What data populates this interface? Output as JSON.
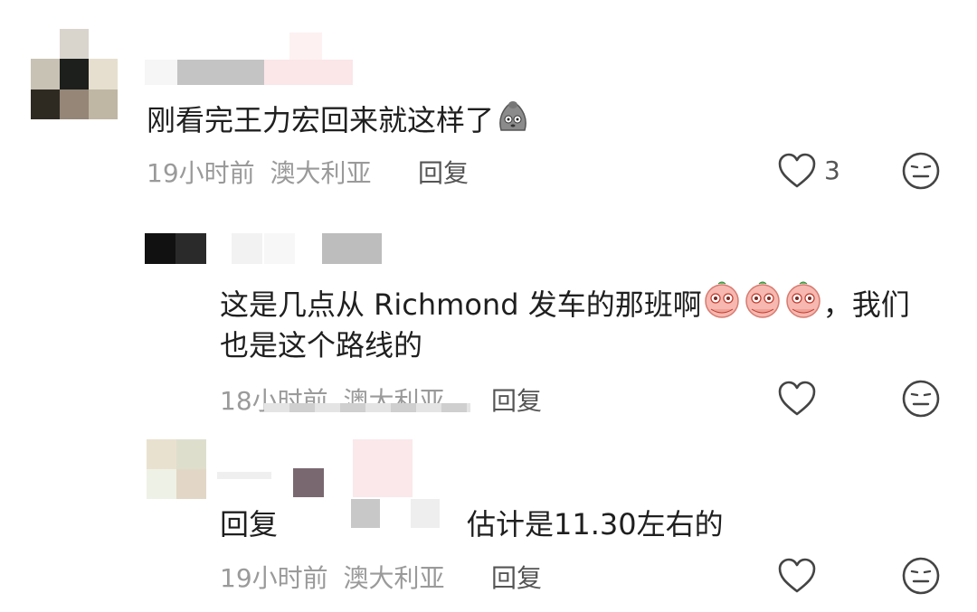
{
  "comments": [
    {
      "text": "刚看完王力宏回来就这样了",
      "time": "19小时前",
      "location": "澳大利亚",
      "reply_label": "回复",
      "likes": "3",
      "emoji": "sweat-blob-emoji"
    },
    {
      "text_part1": "这是几点从 Richmond 发车的那班啊",
      "text_part2": "，我们",
      "text_line2": "也是这个路线的",
      "time": "18小时前",
      "location": "澳大利亚",
      "reply_label": "回复",
      "emoji": "teary-peach-emoji"
    },
    {
      "reply_prefix": "回复",
      "text": "估计是11.30左右的",
      "time": "19小时前",
      "location": "澳大利亚",
      "reply_label": "回复"
    }
  ],
  "colors": {
    "meta_gray": "#9a9a9a",
    "text": "#1f1f1f",
    "icon": "#444444"
  }
}
